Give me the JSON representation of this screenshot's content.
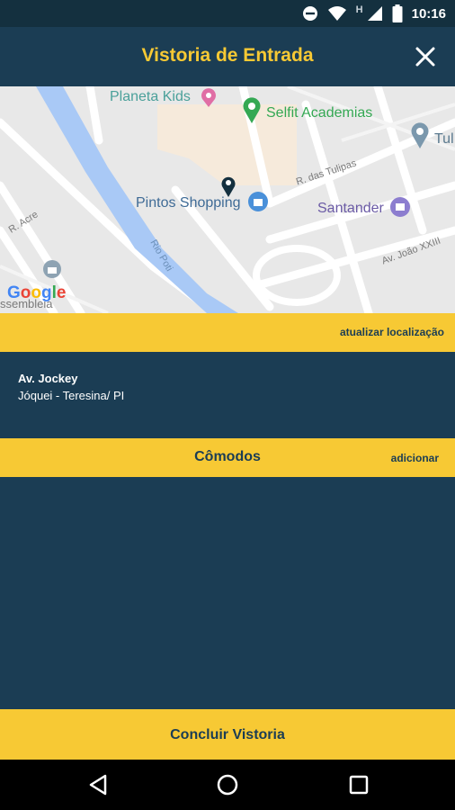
{
  "status_bar": {
    "time": "10:16",
    "network_label": "H",
    "icons": [
      "do-not-disturb-icon",
      "wifi-icon",
      "signal-icon",
      "battery-icon"
    ]
  },
  "header": {
    "title": "Vistoria de Entrada",
    "close_icon": "close-icon"
  },
  "map": {
    "pois": [
      {
        "name": "Planeta Kids",
        "color": "#e06ea5",
        "icon": "shopping-pin-icon"
      },
      {
        "name": "Selfit Academias",
        "color": "#34a853",
        "icon": "pin-icon"
      },
      {
        "name": "Tul",
        "color": "#5b7a8f",
        "icon": "pin-icon"
      },
      {
        "name": "Pintos Shopping",
        "color": "#4a7fb5",
        "icon": "shopping-bag-icon"
      },
      {
        "name": "Santander",
        "color": "#7d6ab5",
        "icon": "bank-icon"
      }
    ],
    "streets": [
      "R. das Tulipas",
      "R. Acre",
      "Av. João XXIII",
      "Rio Poti",
      "ssembleia"
    ],
    "logo": "Google",
    "location_pin": "location-pin-icon"
  },
  "location": {
    "update_label": "atualizar localização",
    "street": "Av. Jockey",
    "city": "Jóquei - Teresina/ PI"
  },
  "rooms": {
    "title": "Cômodos",
    "add_label": "adicionar",
    "items": []
  },
  "footer": {
    "finish_label": "Concluir Vistoria"
  },
  "nav": {
    "icons": [
      "back-icon",
      "home-icon",
      "recents-icon"
    ]
  },
  "colors": {
    "primary": "#1b3d54",
    "accent": "#f7c934",
    "status_bar": "#14303f"
  }
}
